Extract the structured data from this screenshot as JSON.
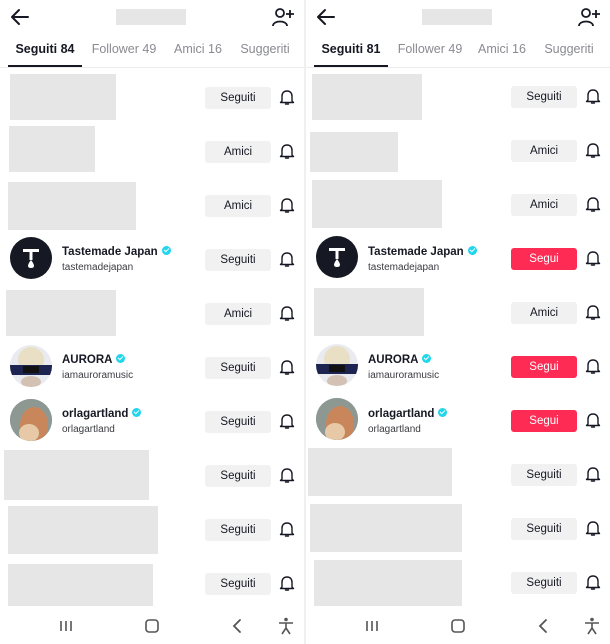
{
  "colors": {
    "follow_red": "#fe2c55",
    "verified_cyan": "#20d5ec",
    "button_gray": "#f1f1f2",
    "blur_gray": "#e6e6e6"
  },
  "icons": {
    "back": "arrow-left-icon",
    "add_user": "person-plus-icon",
    "bell": "bell-icon",
    "verified": "verified-badge-icon"
  },
  "left": {
    "tabs": [
      "Seguiti 84",
      "Follower 49",
      "Amici 16",
      "Suggeriti"
    ],
    "rows": [
      {
        "name": "",
        "handle": "",
        "button": "Seguiti"
      },
      {
        "name": "",
        "handle": "",
        "button": "Amici"
      },
      {
        "name": "",
        "handle": "",
        "button": "Amici"
      },
      {
        "name": "Tastemade Japan",
        "handle": "tastemadejapan",
        "button": "Seguiti"
      },
      {
        "name": "",
        "handle": "",
        "button": "Amici"
      },
      {
        "name": "AURORA",
        "handle": "iamauroramusic",
        "button": "Seguiti"
      },
      {
        "name": "orlagartland",
        "handle": "orlagartland",
        "button": "Seguiti"
      },
      {
        "name": "",
        "handle": "",
        "button": "Seguiti"
      },
      {
        "name": "",
        "handle": "",
        "button": "Seguiti"
      },
      {
        "name": "",
        "handle": "",
        "button": "Seguiti"
      }
    ]
  },
  "right": {
    "tabs": [
      "Seguiti 81",
      "Follower 49",
      "Amici 16",
      "Suggeriti"
    ],
    "rows": [
      {
        "name": "",
        "handle": "",
        "button": "Seguiti"
      },
      {
        "name": "",
        "handle": "",
        "button": "Amici"
      },
      {
        "name": "",
        "handle": "",
        "button": "Amici"
      },
      {
        "name": "Tastemade Japan",
        "handle": "tastemadejapan",
        "button": "Segui"
      },
      {
        "name": "",
        "handle": "",
        "button": "Amici"
      },
      {
        "name": "AURORA",
        "handle": "iamauroramusic",
        "button": "Segui"
      },
      {
        "name": "orlagartland",
        "handle": "orlagartland",
        "button": "Segui"
      },
      {
        "name": "",
        "handle": "",
        "button": "Seguiti"
      },
      {
        "name": "",
        "handle": "",
        "button": "Seguiti"
      },
      {
        "name": "",
        "handle": "",
        "button": "Seguiti"
      }
    ]
  },
  "system_nav": [
    "recent-apps-icon",
    "home-icon",
    "back-nav-icon",
    "accessibility-icon"
  ]
}
